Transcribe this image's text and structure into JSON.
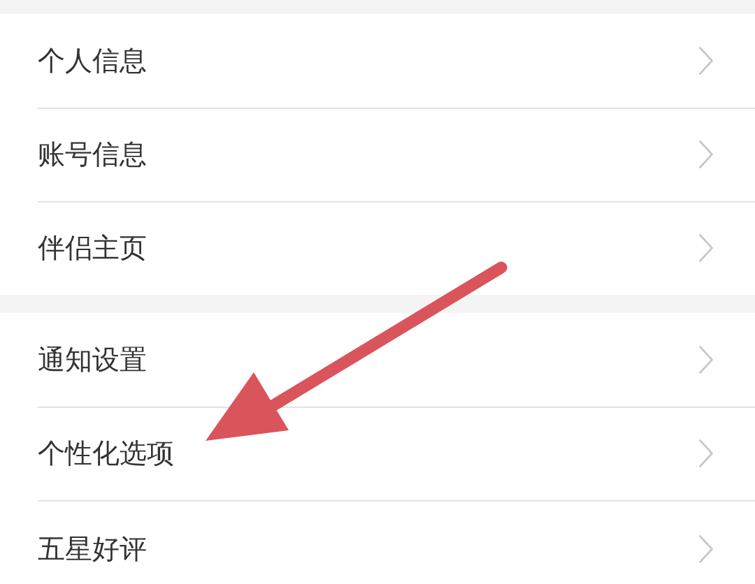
{
  "groups": [
    {
      "items": [
        {
          "label": "个人信息"
        },
        {
          "label": "账号信息"
        },
        {
          "label": "伴侣主页"
        }
      ]
    },
    {
      "items": [
        {
          "label": "通知设置"
        },
        {
          "label": "个性化选项"
        },
        {
          "label": "五星好评"
        }
      ]
    }
  ],
  "annotation": {
    "kind": "arrow"
  }
}
